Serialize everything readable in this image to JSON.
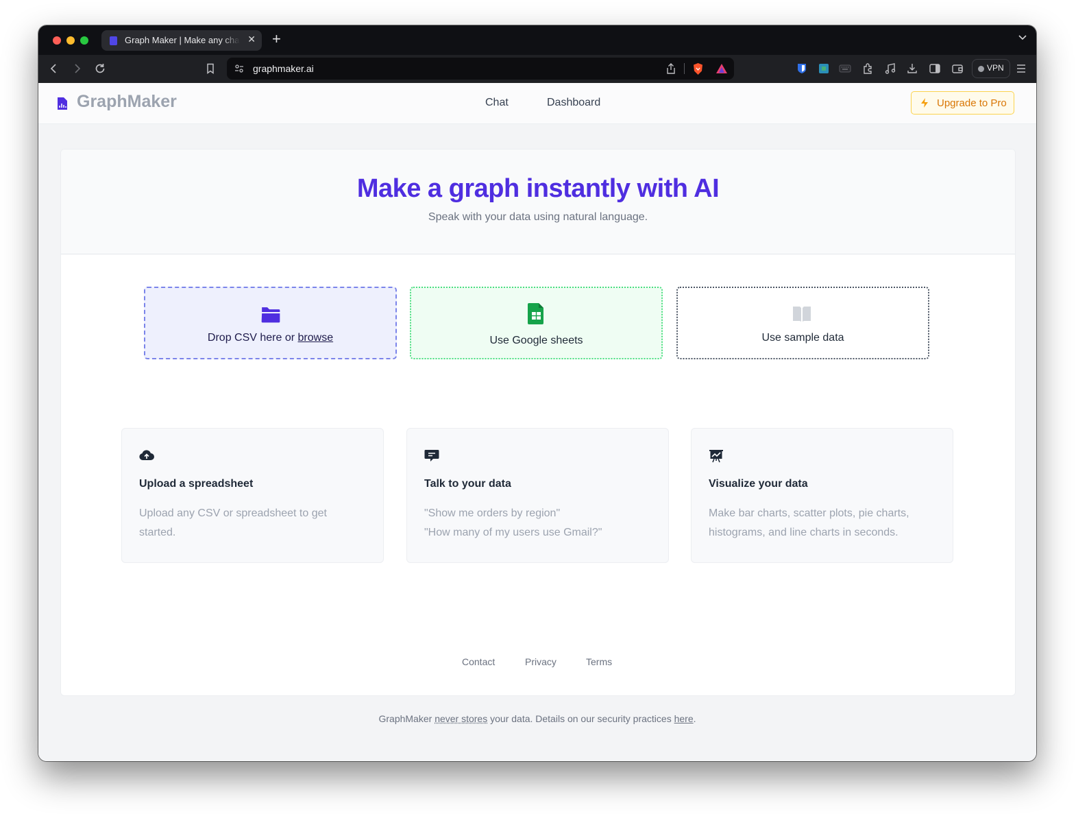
{
  "browser": {
    "tab_title": "Graph Maker | Make any chart",
    "url": "graphmaker.ai",
    "vpn_label": "VPN"
  },
  "nav": {
    "logo": "GraphMaker",
    "links": [
      "Chat",
      "Dashboard"
    ],
    "upgrade_label": "Upgrade to Pro"
  },
  "hero": {
    "title": "Make a graph instantly with AI",
    "subtitle": "Speak with your data using natural language."
  },
  "options": {
    "csv": {
      "label_prefix": "Drop CSV here or ",
      "link": "browse",
      "icon": "folder-icon"
    },
    "sheets": {
      "label": "Use Google sheets",
      "icon": "google-sheets-icon"
    },
    "sample": {
      "label": "Use sample data",
      "icon": "open-book-icon"
    }
  },
  "features": [
    {
      "icon": "cloud-upload-icon",
      "title": "Upload a spreadsheet",
      "lines": [
        "Upload any CSV or spreadsheet to get",
        "started."
      ]
    },
    {
      "icon": "chat-bubble-icon",
      "title": "Talk to your data",
      "lines": [
        "\"Show me orders by region\"",
        "\"How many of my users use Gmail?\""
      ]
    },
    {
      "icon": "presentation-chart-icon",
      "title": "Visualize your data",
      "lines": [
        "Make bar charts, scatter plots, pie charts,",
        "histograms, and line charts in seconds."
      ]
    }
  ],
  "footer": {
    "links": [
      "Contact",
      "Privacy",
      "Terms"
    ],
    "note": {
      "part1": "GraphMaker ",
      "never_stores": "never stores",
      "part2": " your data. Details on our security practices ",
      "here": "here",
      "part3": "."
    }
  },
  "colors": {
    "accent": "#4f2ee0",
    "upgrade": "#d97706",
    "sheets_green": "#16a34a"
  }
}
